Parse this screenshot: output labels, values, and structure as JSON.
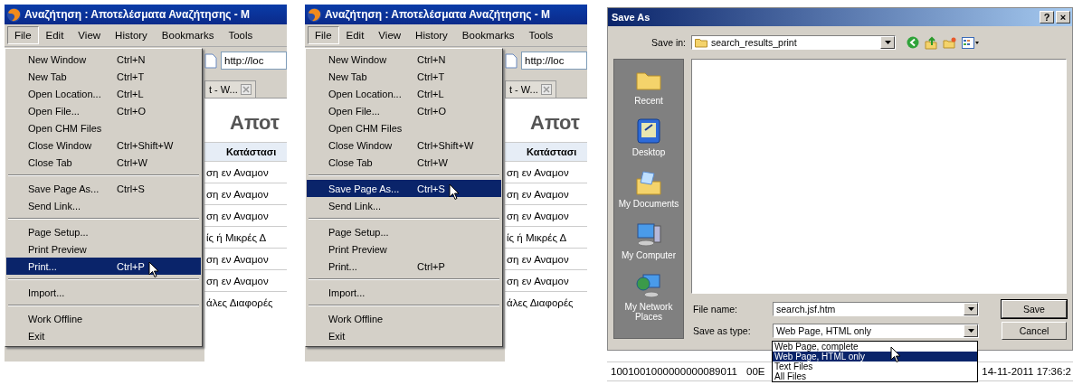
{
  "browsers": [
    {
      "title": "Αναζήτηση : Αποτελέσματα Αναζήτησης - M",
      "menubar": [
        {
          "label": "File",
          "selected": true
        },
        {
          "label": "Edit",
          "selected": false
        },
        {
          "label": "View",
          "selected": false
        },
        {
          "label": "History",
          "selected": false
        },
        {
          "label": "Bookmarks",
          "selected": false
        },
        {
          "label": "Tools",
          "selected": false
        }
      ],
      "address": "http://loc",
      "tab": "t - W...",
      "heading": "Αποτ",
      "column": "Κατάστασι",
      "rows": [
        "ση εν Αναμον",
        "ση εν Αναμον",
        "ση εν Αναμον",
        "ίς ή Μικρές Δ",
        "ση εν Αναμον",
        "ση εν Αναμον",
        "άλες Διαφορές"
      ],
      "menu": [
        {
          "kind": "item",
          "label": "New Window",
          "shortcut": "Ctrl+N",
          "selected": false
        },
        {
          "kind": "item",
          "label": "New Tab",
          "shortcut": "Ctrl+T",
          "selected": false
        },
        {
          "kind": "item",
          "label": "Open Location...",
          "shortcut": "Ctrl+L",
          "selected": false
        },
        {
          "kind": "item",
          "label": "Open File...",
          "shortcut": "Ctrl+O",
          "selected": false
        },
        {
          "kind": "item",
          "label": "Open CHM Files",
          "selected": false
        },
        {
          "kind": "item",
          "label": "Close Window",
          "shortcut": "Ctrl+Shift+W",
          "selected": false
        },
        {
          "kind": "item",
          "label": "Close Tab",
          "shortcut": "Ctrl+W",
          "selected": false
        },
        {
          "kind": "separator"
        },
        {
          "kind": "item",
          "label": "Save Page As...",
          "shortcut": "Ctrl+S",
          "selected": false
        },
        {
          "kind": "item",
          "label": "Send Link...",
          "selected": false
        },
        {
          "kind": "separator"
        },
        {
          "kind": "item",
          "label": "Page Setup...",
          "selected": false
        },
        {
          "kind": "item",
          "label": "Print Preview",
          "selected": false
        },
        {
          "kind": "item",
          "label": "Print...",
          "shortcut": "Ctrl+P",
          "selected": true
        },
        {
          "kind": "separator"
        },
        {
          "kind": "item",
          "label": "Import...",
          "selected": false
        },
        {
          "kind": "separator"
        },
        {
          "kind": "item",
          "label": "Work Offline",
          "selected": false
        },
        {
          "kind": "item",
          "label": "Exit",
          "selected": false
        }
      ]
    },
    {
      "title": "Αναζήτηση : Αποτελέσματα Αναζήτησης - M",
      "menubar": [
        {
          "label": "File",
          "selected": true
        },
        {
          "label": "Edit",
          "selected": false
        },
        {
          "label": "View",
          "selected": false
        },
        {
          "label": "History",
          "selected": false
        },
        {
          "label": "Bookmarks",
          "selected": false
        },
        {
          "label": "Tools",
          "selected": false
        }
      ],
      "address": "http://loc",
      "tab": "t - W...",
      "heading": "Αποτ",
      "column": "Κατάστασι",
      "rows": [
        "ση εν Αναμον",
        "ση εν Αναμον",
        "ση εν Αναμον",
        "ίς ή Μικρές Δ",
        "ση εν Αναμον",
        "ση εν Αναμον",
        "άλες Διαφορές"
      ],
      "menu": [
        {
          "kind": "item",
          "label": "New Window",
          "shortcut": "Ctrl+N",
          "selected": false
        },
        {
          "kind": "item",
          "label": "New Tab",
          "shortcut": "Ctrl+T",
          "selected": false
        },
        {
          "kind": "item",
          "label": "Open Location...",
          "shortcut": "Ctrl+L",
          "selected": false
        },
        {
          "kind": "item",
          "label": "Open File...",
          "shortcut": "Ctrl+O",
          "selected": false
        },
        {
          "kind": "item",
          "label": "Open CHM Files",
          "selected": false
        },
        {
          "kind": "item",
          "label": "Close Window",
          "shortcut": "Ctrl+Shift+W",
          "selected": false
        },
        {
          "kind": "item",
          "label": "Close Tab",
          "shortcut": "Ctrl+W",
          "selected": false
        },
        {
          "kind": "separator"
        },
        {
          "kind": "item",
          "label": "Save Page As...",
          "shortcut": "Ctrl+S",
          "selected": true
        },
        {
          "kind": "item",
          "label": "Send Link...",
          "selected": false
        },
        {
          "kind": "separator"
        },
        {
          "kind": "item",
          "label": "Page Setup...",
          "selected": false
        },
        {
          "kind": "item",
          "label": "Print Preview",
          "selected": false
        },
        {
          "kind": "item",
          "label": "Print...",
          "shortcut": "Ctrl+P",
          "selected": false
        },
        {
          "kind": "separator"
        },
        {
          "kind": "item",
          "label": "Import...",
          "selected": false
        },
        {
          "kind": "separator"
        },
        {
          "kind": "item",
          "label": "Work Offline",
          "selected": false
        },
        {
          "kind": "item",
          "label": "Exit",
          "selected": false
        }
      ]
    }
  ],
  "dialog": {
    "title": "Save As",
    "title_buttons": [
      "?",
      "×"
    ],
    "save_in_label": "Save in:",
    "save_in_value": "search_results_print",
    "places": [
      {
        "kind": "recent",
        "label": "Recent"
      },
      {
        "kind": "desktop",
        "label": "Desktop"
      },
      {
        "kind": "documents",
        "label": "My Documents"
      },
      {
        "kind": "computer",
        "label": "My Computer"
      },
      {
        "kind": "network",
        "label": "My Network Places"
      }
    ],
    "file_name_label": "File name:",
    "file_name": "search.jsf.htm",
    "type_label": "Save as type:",
    "type_value": "Web Page, HTML only",
    "buttons": [
      "Save",
      "Cancel"
    ],
    "type_options": [
      {
        "label": "Web Page, complete",
        "selected": false
      },
      {
        "label": "Web Page, HTML only",
        "selected": true
      },
      {
        "label": "Text Files",
        "selected": false
      },
      {
        "label": "All Files",
        "selected": false
      }
    ],
    "background_row": [
      "1001001000000000089011",
      "00E",
      "14-11-2011 17:36:2"
    ]
  }
}
